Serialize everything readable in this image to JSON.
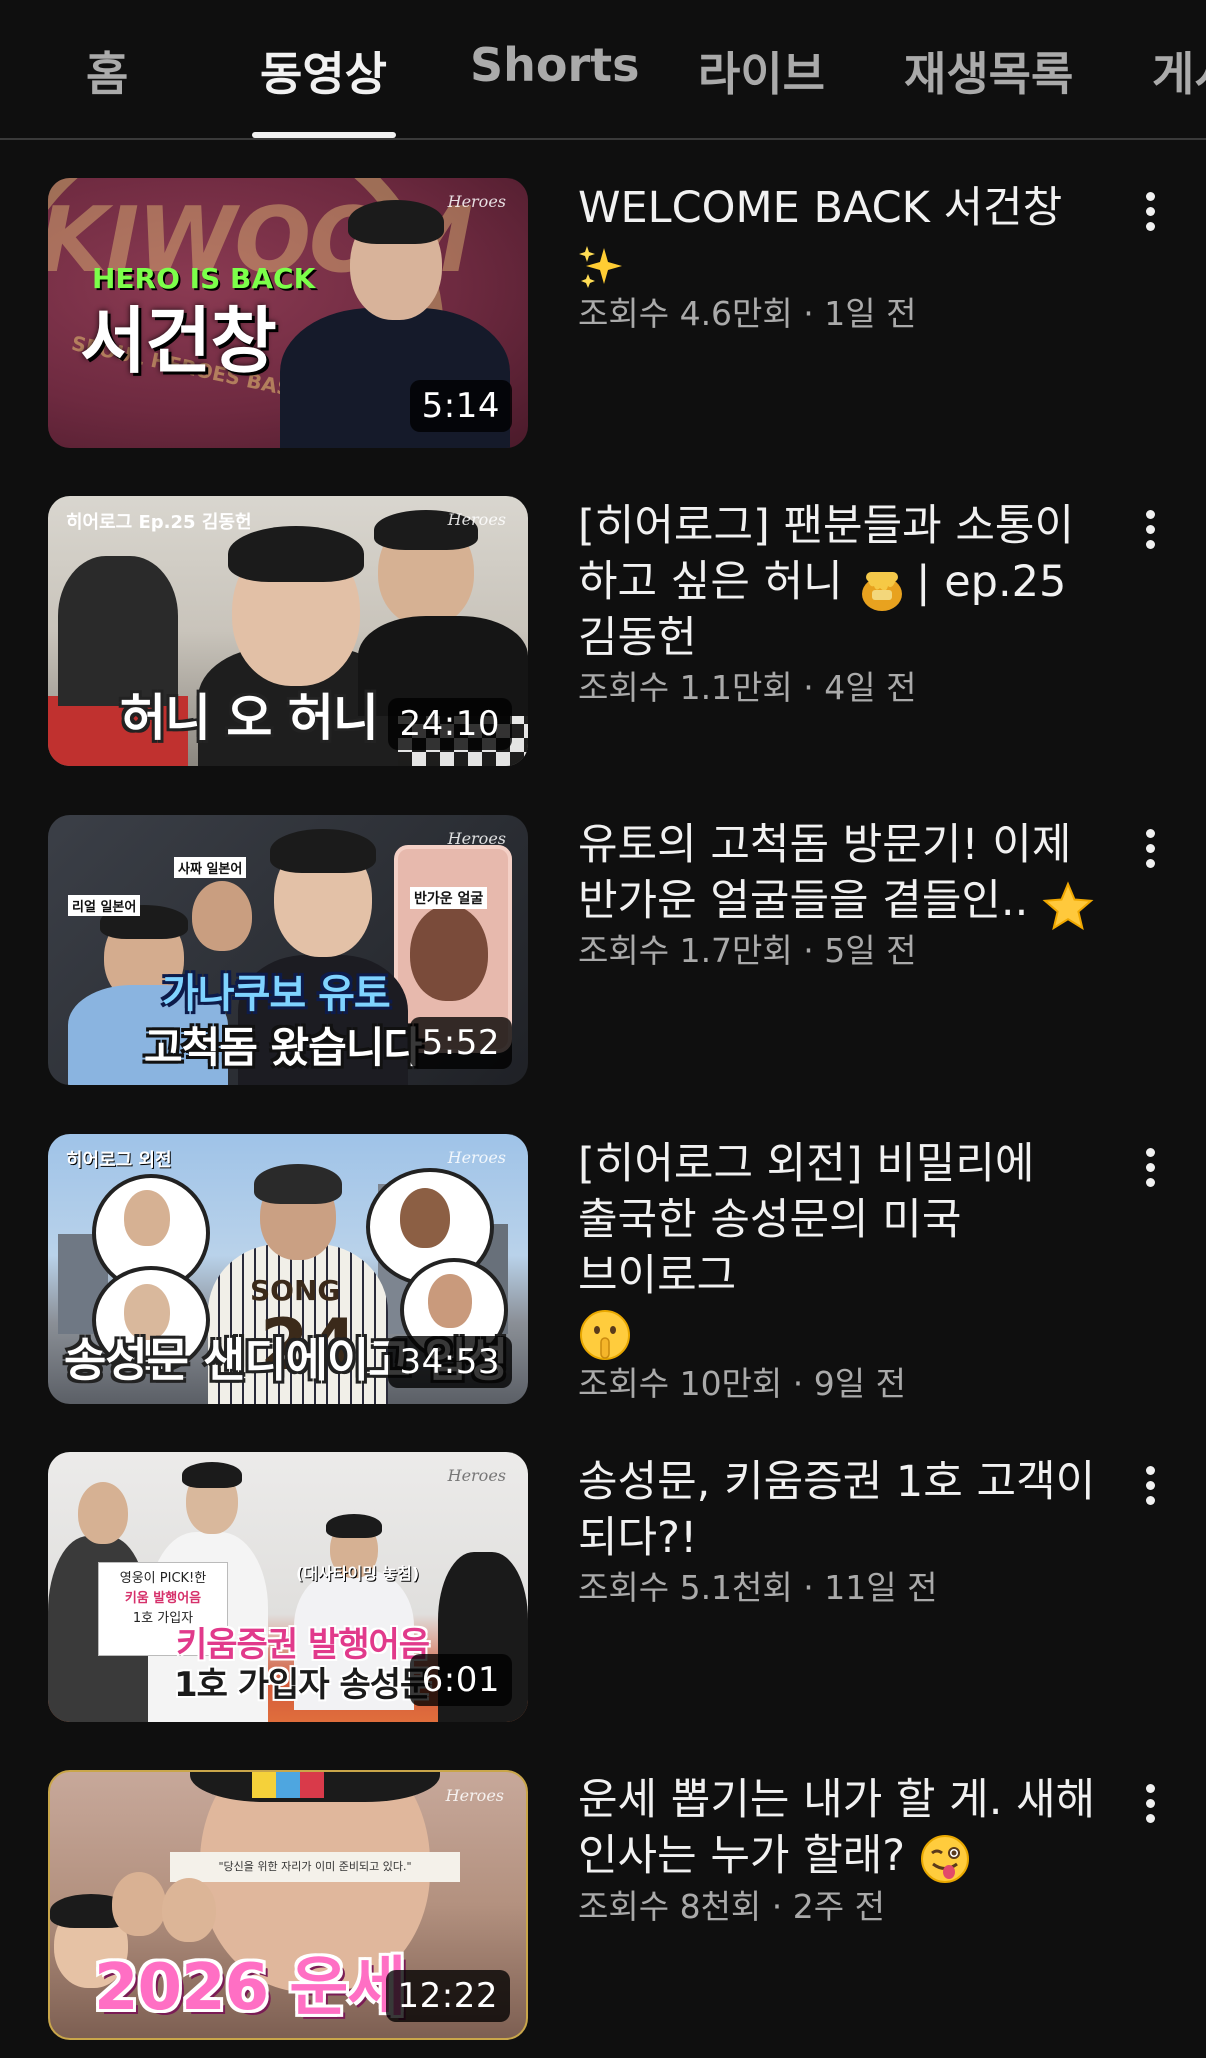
{
  "tabs": [
    {
      "label": "홈",
      "active": false
    },
    {
      "label": "동영상",
      "active": true
    },
    {
      "label": "Shorts",
      "active": false
    },
    {
      "label": "라이브",
      "active": false
    },
    {
      "label": "재생목록",
      "active": false
    },
    {
      "label": "게시",
      "active": false
    }
  ],
  "videos": [
    {
      "title": "WELCOME BACK 서건창",
      "title_emoji": "sparkles",
      "meta": "조회수 4.6만회 · 1일 전",
      "duration": "5:14",
      "thumb_text": "서건창",
      "thumb_tag": "HERO IS BACK",
      "thumb_bg_text": "KIWOOM",
      "thumb_ring_text": "SEOUL HEROES BASEBALL CLUB"
    },
    {
      "title": "[히어로그] 팬분들과 소통이 하고 싶은 허니",
      "title_emoji": "honey-pot",
      "title_suffix": " | ep.25 김동헌",
      "meta": "조회수 1.1만회 · 4일 전",
      "duration": "24:10",
      "thumb_text": "허니 오 허니",
      "thumb_tag": "히어로그 Ep.25 김동헌"
    },
    {
      "title": "유토의 고척돔 방문기! 이제 반가운 얼굴들을 곁들인..",
      "title_emoji": "star",
      "meta": "조회수 1.7만회 · 5일 전",
      "duration": "5:52",
      "thumb_text": "가나쿠보 유토",
      "thumb_text2": "고척돔 왔습니다",
      "thumb_labels": [
        "리얼 일본어",
        "사짜 일본어",
        "반가운 얼굴"
      ]
    },
    {
      "title": "[히어로그 외전] 비밀리에 출국한 송성문의 미국 브이로그",
      "title_emoji": "shushing-face",
      "meta": "조회수 10만회 · 9일 전",
      "duration": "34:53",
      "thumb_text": "송성문 샌디에이고 입성",
      "thumb_tag": "히어로그 외전",
      "jersey_name": "SONG",
      "jersey_number": "24"
    },
    {
      "title": "송성문, 키움증권 1호 고객이 되다?!",
      "title_emoji": "",
      "meta": "조회수 5.1천회 · 11일 전",
      "duration": "6:01",
      "thumb_text": "키움증권 발행어음",
      "thumb_text2": "1호 가입자 송성문",
      "thumb_sign": [
        "영웅이 PICK!한",
        "키움 발행어음",
        "1호 가입자"
      ],
      "thumb_note": "(대사타이밍 놓침)"
    },
    {
      "title": "운세 뽑기는 내가 할 게. 새해 인사는 누가 할래?",
      "title_emoji": "winking-tongue-face",
      "meta": "조회수 8천회 · 2주 전",
      "duration": "12:22",
      "thumb_text": "2026 운세",
      "thumb_quote": "\"당신을 위한 자리가 이미 준비되고 있다.\""
    }
  ],
  "thumb_logo": "Heroes",
  "colors": {
    "background": "#0f0f0f",
    "text_primary": "#f1f1f1",
    "text_secondary": "#aaaaaa",
    "divider": "#3a3a3a"
  }
}
